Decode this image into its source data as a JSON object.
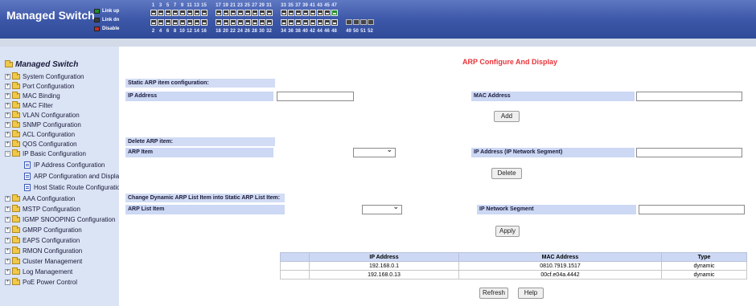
{
  "banner": {
    "brand": "Managed Switch",
    "legend": [
      "Link up",
      "Link dn",
      "Disable"
    ],
    "port_numbers_odd": [
      "1",
      "3",
      "5",
      "7",
      "9",
      "11",
      "13",
      "15",
      "17",
      "19",
      "21",
      "23",
      "25",
      "27",
      "29",
      "31",
      "33",
      "35",
      "37",
      "39",
      "41",
      "43",
      "45",
      "47"
    ],
    "port_numbers_even": [
      "2",
      "4",
      "6",
      "8",
      "10",
      "12",
      "14",
      "16",
      "18",
      "20",
      "22",
      "24",
      "26",
      "28",
      "30",
      "32",
      "34",
      "36",
      "38",
      "40",
      "42",
      "44",
      "46",
      "48"
    ],
    "uplink_numbers": [
      "49",
      "50",
      "51",
      "52"
    ],
    "colors": {
      "link_up": "#1f8f2a",
      "link_dn": "#3a3a3a",
      "disable": "#c0302a"
    }
  },
  "sidebar": {
    "root": "Managed Switch",
    "items": [
      "System Configuration",
      "Port Configuration",
      "MAC Binding",
      "MAC Filter",
      "VLAN Configuration",
      "SNMP Configuration",
      "ACL Configuration",
      "QOS Configuration",
      "IP Basic Configuration"
    ],
    "sub_items": [
      "IP Address Configuration",
      "ARP Configuration and Display",
      "Host Static Route Configuration"
    ],
    "items_after": [
      "AAA Configuration",
      "MSTP Configuration",
      "IGMP SNOOPING Configuration",
      "GMRP Configuration",
      "EAPS Configuration",
      "RMON Configuration",
      "Cluster Management",
      "Log Management",
      "PoE Power Control"
    ]
  },
  "main": {
    "title": "ARP Configure And Display",
    "static": {
      "header": "Static ARP item configuration:",
      "ip_label": "IP Address",
      "mac_label": "MAC Address",
      "ip_value": "",
      "mac_value": "",
      "add_button": "Add"
    },
    "delete": {
      "header": "Delete ARP item:",
      "arp_label": "ARP Item",
      "segment_label": "IP Address (IP Network Segment)",
      "arp_selected": "",
      "segment_value": "",
      "delete_button": "Delete"
    },
    "change": {
      "header": "Change Dynamic ARP List Item into Static ARP List Item:",
      "list_label": "ARP List Item",
      "segment_label": "IP Network Segment",
      "list_selected": "",
      "segment_value": "",
      "apply_button": "Apply"
    },
    "table": {
      "headers": [
        "",
        "IP Address",
        "MAC Address",
        "Type"
      ],
      "rows": [
        {
          "ip": "192.168.0.1",
          "mac": "0810.7919.1517",
          "type": "dynamic"
        },
        {
          "ip": "192.168.0.13",
          "mac": "00cf.e04a.4442",
          "type": "dynamic"
        }
      ]
    },
    "refresh_button": "Refresh",
    "help_button": "Help"
  }
}
